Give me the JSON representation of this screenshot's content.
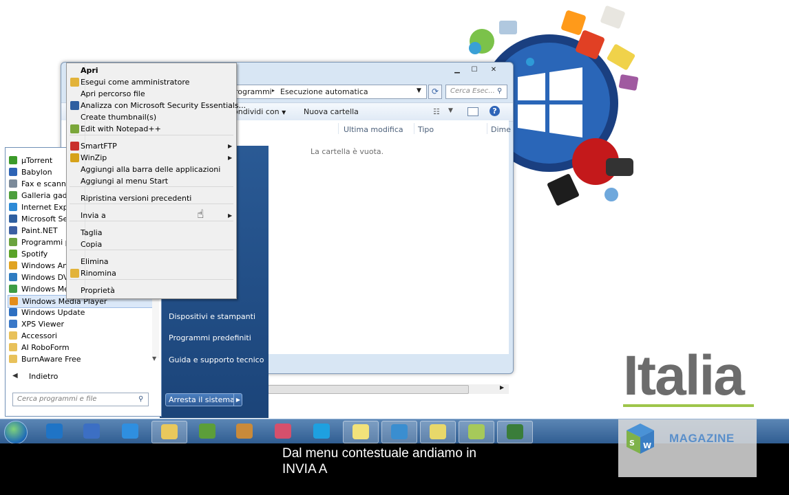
{
  "explorer": {
    "breadcrumb_prev": "rogrammi",
    "breadcrumb_sep": "▸",
    "breadcrumb_current": "Esecuzione automatica",
    "search_placeholder": "Cerca Esec...",
    "toolbar": {
      "share": "ondividi con",
      "new_folder": "Nuova cartella"
    },
    "columns": [
      "Ultima modifica",
      "Tipo",
      "Dime"
    ],
    "empty_message": "La cartella è vuota."
  },
  "start_menu": {
    "programs": [
      {
        "label": "µTorrent",
        "icon": "utorrent-icon",
        "color": "#3b9a29"
      },
      {
        "label": "Babylon",
        "icon": "babylon-icon",
        "color": "#2d63b5"
      },
      {
        "label": "Fax e scanner c",
        "icon": "fax-icon",
        "color": "#7b8a9a"
      },
      {
        "label": "Galleria gadge",
        "icon": "gadget-icon",
        "color": "#4d9f3d"
      },
      {
        "label": "Internet Explor",
        "icon": "ie-icon",
        "color": "#2d8ad6"
      },
      {
        "label": "Microsoft Secu",
        "icon": "security-icon",
        "color": "#2f5fa0"
      },
      {
        "label": "Paint.NET",
        "icon": "paintnet-icon",
        "color": "#3c5fa3"
      },
      {
        "label": "Programmi pr",
        "icon": "programs-icon",
        "color": "#6aa33e"
      },
      {
        "label": "Spotify",
        "icon": "spotify-icon",
        "color": "#5aa328"
      },
      {
        "label": "Windows Anyt",
        "icon": "anytime-icon",
        "color": "#e0a321"
      },
      {
        "label": "Windows DVD",
        "icon": "dvd-icon",
        "color": "#2f7cc1"
      },
      {
        "label": "Windows Med",
        "icon": "media-center-icon",
        "color": "#3d9c45"
      },
      {
        "label": "Windows Media Player",
        "icon": "media-player-icon",
        "color": "#e48d1b"
      },
      {
        "label": "Windows Update",
        "icon": "update-icon",
        "color": "#2d6fc1"
      },
      {
        "label": "XPS Viewer",
        "icon": "xps-icon",
        "color": "#3a78c8"
      },
      {
        "label": "Accessori",
        "icon": "folder-icon",
        "color": "#e8c15a"
      },
      {
        "label": "AI RoboForm",
        "icon": "folder-icon",
        "color": "#e8c15a"
      },
      {
        "label": "BurnAware Free",
        "icon": "folder-icon",
        "color": "#e8c15a"
      }
    ],
    "selected_index": 12,
    "back_label": "Indietro",
    "search_placeholder": "Cerca programmi e file",
    "right_links": [
      "Dispositivi e stampanti",
      "Programmi predefiniti",
      "Guida e supporto tecnico"
    ],
    "shutdown_label": "Arresta il sistema"
  },
  "context_menu": {
    "items": [
      {
        "label": "Apri",
        "bold": true,
        "icon": null,
        "submenu": false
      },
      {
        "label": "Esegui come amministratore",
        "icon": "shield-icon",
        "submenu": false
      },
      {
        "label": "Apri percorso file",
        "icon": null,
        "submenu": false
      },
      {
        "label": "Analizza con Microsoft Security Essentials...",
        "icon": "security-essentials-icon",
        "submenu": false
      },
      {
        "label": "Create thumbnail(s)",
        "icon": null,
        "submenu": false
      },
      {
        "label": "Edit with Notepad++",
        "icon": "notepadpp-icon",
        "submenu": false
      },
      {
        "label": "SmartFTP",
        "icon": "smartftp-icon",
        "submenu": true
      },
      {
        "label": "WinZip",
        "icon": "winzip-icon",
        "submenu": true
      },
      {
        "label": "Aggiungi alla barra delle applicazioni",
        "icon": null,
        "submenu": false
      },
      {
        "label": "Aggiungi al menu Start",
        "icon": null,
        "submenu": false
      },
      {
        "label": "Ripristina versioni precedenti",
        "icon": null,
        "submenu": false
      },
      {
        "label": "Invia a",
        "icon": null,
        "submenu": true
      },
      {
        "label": "Taglia",
        "icon": null,
        "submenu": false
      },
      {
        "label": "Copia",
        "icon": null,
        "submenu": false
      },
      {
        "label": "Elimina",
        "icon": null,
        "submenu": false
      },
      {
        "label": "Rinomina",
        "icon": "shield-icon",
        "submenu": false
      },
      {
        "label": "Proprietà",
        "icon": null,
        "submenu": false
      }
    ]
  },
  "taskbar": {
    "apps": [
      {
        "name": "bing-browser-icon",
        "color": "#1f74c6"
      },
      {
        "name": "firefox-icon",
        "color": "#3c6fc4"
      },
      {
        "name": "internet-explorer-icon",
        "color": "#2f8fe0"
      },
      {
        "name": "explorer-icon",
        "color": "#e9c85c",
        "active": true
      },
      {
        "name": "evernote-icon",
        "color": "#5c9e3a"
      },
      {
        "name": "paint-icon",
        "color": "#c98a3a"
      },
      {
        "name": "itunes-icon",
        "color": "#d5506c"
      },
      {
        "name": "skype-icon",
        "color": "#1ea0e0"
      },
      {
        "name": "notes-icon",
        "color": "#f2e27a",
        "active": true
      },
      {
        "name": "stack-icon",
        "color": "#3a8ed0",
        "active": true
      },
      {
        "name": "notepad-icon",
        "color": "#e8d86a",
        "active": true
      },
      {
        "name": "document-icon",
        "color": "#a6c95a",
        "active": true
      },
      {
        "name": "camtasia-icon",
        "color": "#3a7d3a",
        "active": true
      }
    ]
  },
  "subtitle": {
    "line1": "Dal menu contestuale andiamo in",
    "line2": "INVIA A"
  },
  "branding": {
    "italia": "Italia",
    "magazine": "MAGAZINE",
    "cube_letters": [
      "S",
      "W"
    ]
  }
}
